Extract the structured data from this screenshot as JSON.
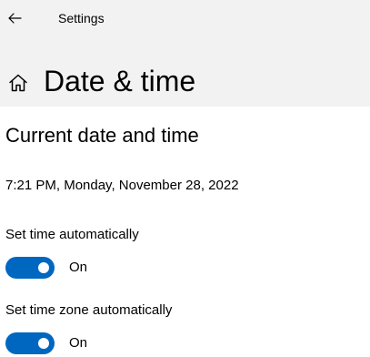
{
  "titlebar": {
    "back_icon": "back-arrow-icon",
    "app_title": "Settings"
  },
  "header": {
    "home_icon": "home-icon",
    "page_title": "Date & time"
  },
  "section": {
    "title": "Current date and time",
    "current_datetime": "7:21 PM, Monday, November 28, 2022"
  },
  "settings": {
    "auto_time": {
      "label": "Set time automatically",
      "state": "On",
      "enabled": true
    },
    "auto_timezone": {
      "label": "Set time zone automatically",
      "state": "On",
      "enabled": true
    }
  },
  "colors": {
    "accent": "#0067c0",
    "header_background": "#f2f2f2"
  }
}
